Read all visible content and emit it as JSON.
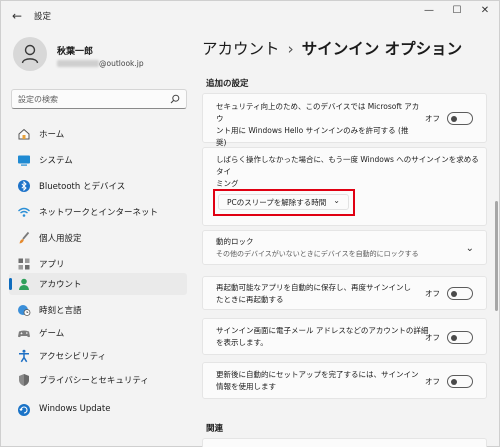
{
  "window": {
    "title": "設定",
    "back_icon": "←",
    "minimize": "—",
    "maximize": "☐",
    "close": "✕"
  },
  "profile": {
    "name": "秋葉一郎",
    "email_suffix": "@outlook.jp"
  },
  "search": {
    "placeholder": "設定の検索"
  },
  "sidebar": {
    "items": [
      {
        "label": "ホーム",
        "icon": "home-icon"
      },
      {
        "label": "システム",
        "icon": "system-icon"
      },
      {
        "label": "Bluetooth とデバイス",
        "icon": "bluetooth-icon"
      },
      {
        "label": "ネットワークとインターネット",
        "icon": "network-icon"
      },
      {
        "label": "個人用設定",
        "icon": "brush-icon"
      },
      {
        "label": "アプリ",
        "icon": "apps-icon"
      },
      {
        "label": "アカウント",
        "icon": "account-icon",
        "active": true
      },
      {
        "label": "時刻と言語",
        "icon": "time-language-icon"
      },
      {
        "label": "ゲーム",
        "icon": "gaming-icon"
      },
      {
        "label": "アクセシビリティ",
        "icon": "accessibility-icon"
      },
      {
        "label": "プライバシーとセキュリティ",
        "icon": "shield-icon"
      },
      {
        "label": "Windows Update",
        "icon": "windows-update-icon"
      }
    ]
  },
  "main": {
    "breadcrumb_parent": "アカウント",
    "breadcrumb_sep": "›",
    "breadcrumb_current": "サインイン オプション",
    "section_additional": "追加の設定",
    "section_related": "関連",
    "cards": {
      "hello_only": {
        "text_line1": "セキュリティ向上のため、このデバイスでは Microsoft アカウ",
        "text_line2": "ント用に Windows Hello サインインのみを許可する (推",
        "text_line3": "奨)",
        "toggle_label": "オフ"
      },
      "require_signin": {
        "text_line1": "しばらく操作しなかった場合に、もう一度 Windows へのサインインを求めるタイ",
        "text_line2": "ミング",
        "dropdown_value": "PCのスリープを解除する時間",
        "dropdown_chevron": "⌄"
      },
      "dynamic_lock": {
        "title": "動的ロック",
        "subtitle": "その他のデバイスがいないときにデバイスを自動的にロックする",
        "chevron": "⌄"
      },
      "restart_apps": {
        "text_line1": "再起動可能なアプリを自動的に保存し、再度サインインし",
        "text_line2": "たときに再起動する",
        "toggle_label": "オフ"
      },
      "show_account_details": {
        "text_line1": "サインイン画面に電子メール アドレスなどのアカウントの詳細",
        "text_line2": "を表示します。",
        "toggle_label": "オフ"
      },
      "use_signin_info": {
        "text_line1": "更新後に自動的にセットアップを完了するには、サインイン",
        "text_line2": "情報を使用します",
        "toggle_label": "オフ"
      }
    }
  },
  "colors": {
    "accent": "#0f6cbd",
    "highlight": "#e00012"
  }
}
